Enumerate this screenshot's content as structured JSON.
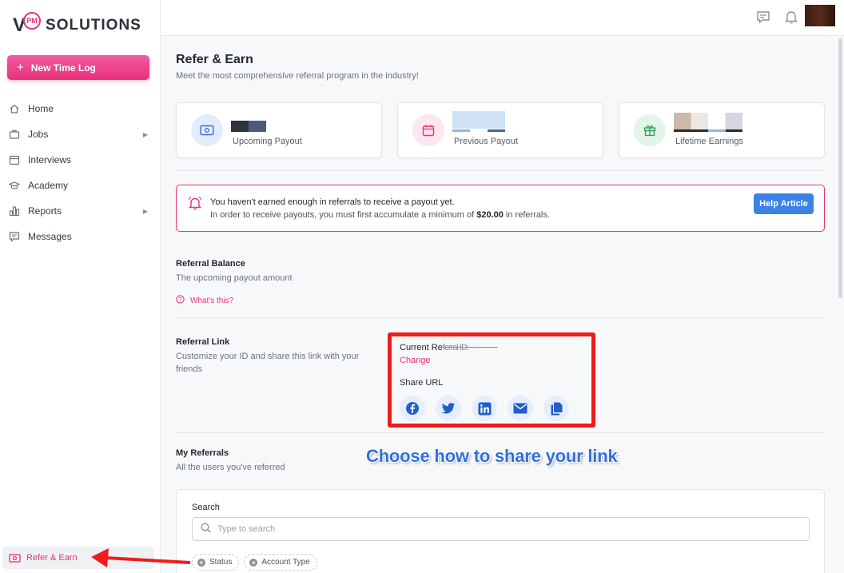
{
  "brand": {
    "v": "V",
    "pm": "PM",
    "name": "SOLUTIONS",
    "accent": "#e8317a"
  },
  "sidebar": {
    "new_button": "New Time Log",
    "items": [
      {
        "label": "Home",
        "icon": "home-icon",
        "has_arrow": false
      },
      {
        "label": "Jobs",
        "icon": "briefcase-icon",
        "has_arrow": true
      },
      {
        "label": "Interviews",
        "icon": "calendar-icon",
        "has_arrow": false
      },
      {
        "label": "Academy",
        "icon": "graduation-cap-icon",
        "has_arrow": false
      },
      {
        "label": "Reports",
        "icon": "bar-chart-icon",
        "has_arrow": true
      },
      {
        "label": "Messages",
        "icon": "message-icon",
        "has_arrow": false
      }
    ],
    "refer_item": "Refer & Earn"
  },
  "header": {
    "icons": [
      "chat-icon",
      "bell-icon"
    ]
  },
  "page": {
    "title": "Refer & Earn",
    "subtitle": "Meet the most comprehensive referral program in the industry!"
  },
  "stats": [
    {
      "label": "Upcoming Payout",
      "icon": "money-icon",
      "color": "#e3ecfb"
    },
    {
      "label": "Previous Payout",
      "icon": "calendar-icon",
      "color": "#fde6ef"
    },
    {
      "label": "Lifetime Earnings",
      "icon": "gift-icon",
      "color": "#e2f5e8"
    }
  ],
  "alert": {
    "line1": "You haven't earned enough in referrals to receive a payout yet.",
    "line2_pre": "In order to receive payouts, you must first accumulate a minimum of ",
    "line2_amount": "$20.00",
    "line2_post": " in referrals.",
    "button": "Help Article"
  },
  "balance": {
    "title": "Referral Balance",
    "subtitle": "The upcoming payout amount",
    "whats_this": "What's this?"
  },
  "referral_link": {
    "title": "Referral Link",
    "subtitle": "Customize your ID and share this link with your friends",
    "current_label": "Current Re",
    "current_blurred": "ferral ID: ·············",
    "change": "Change",
    "share_url": "Share URL",
    "socials": [
      "facebook-icon",
      "twitter-icon",
      "linkedin-icon",
      "email-icon",
      "copy-icon"
    ]
  },
  "annotation": "Choose how to share your link",
  "my_referrals": {
    "title": "My Referrals",
    "subtitle": "All the users you've referred",
    "search_label": "Search",
    "search_placeholder": "Type to search",
    "filters": [
      "Status",
      "Account Type"
    ]
  }
}
